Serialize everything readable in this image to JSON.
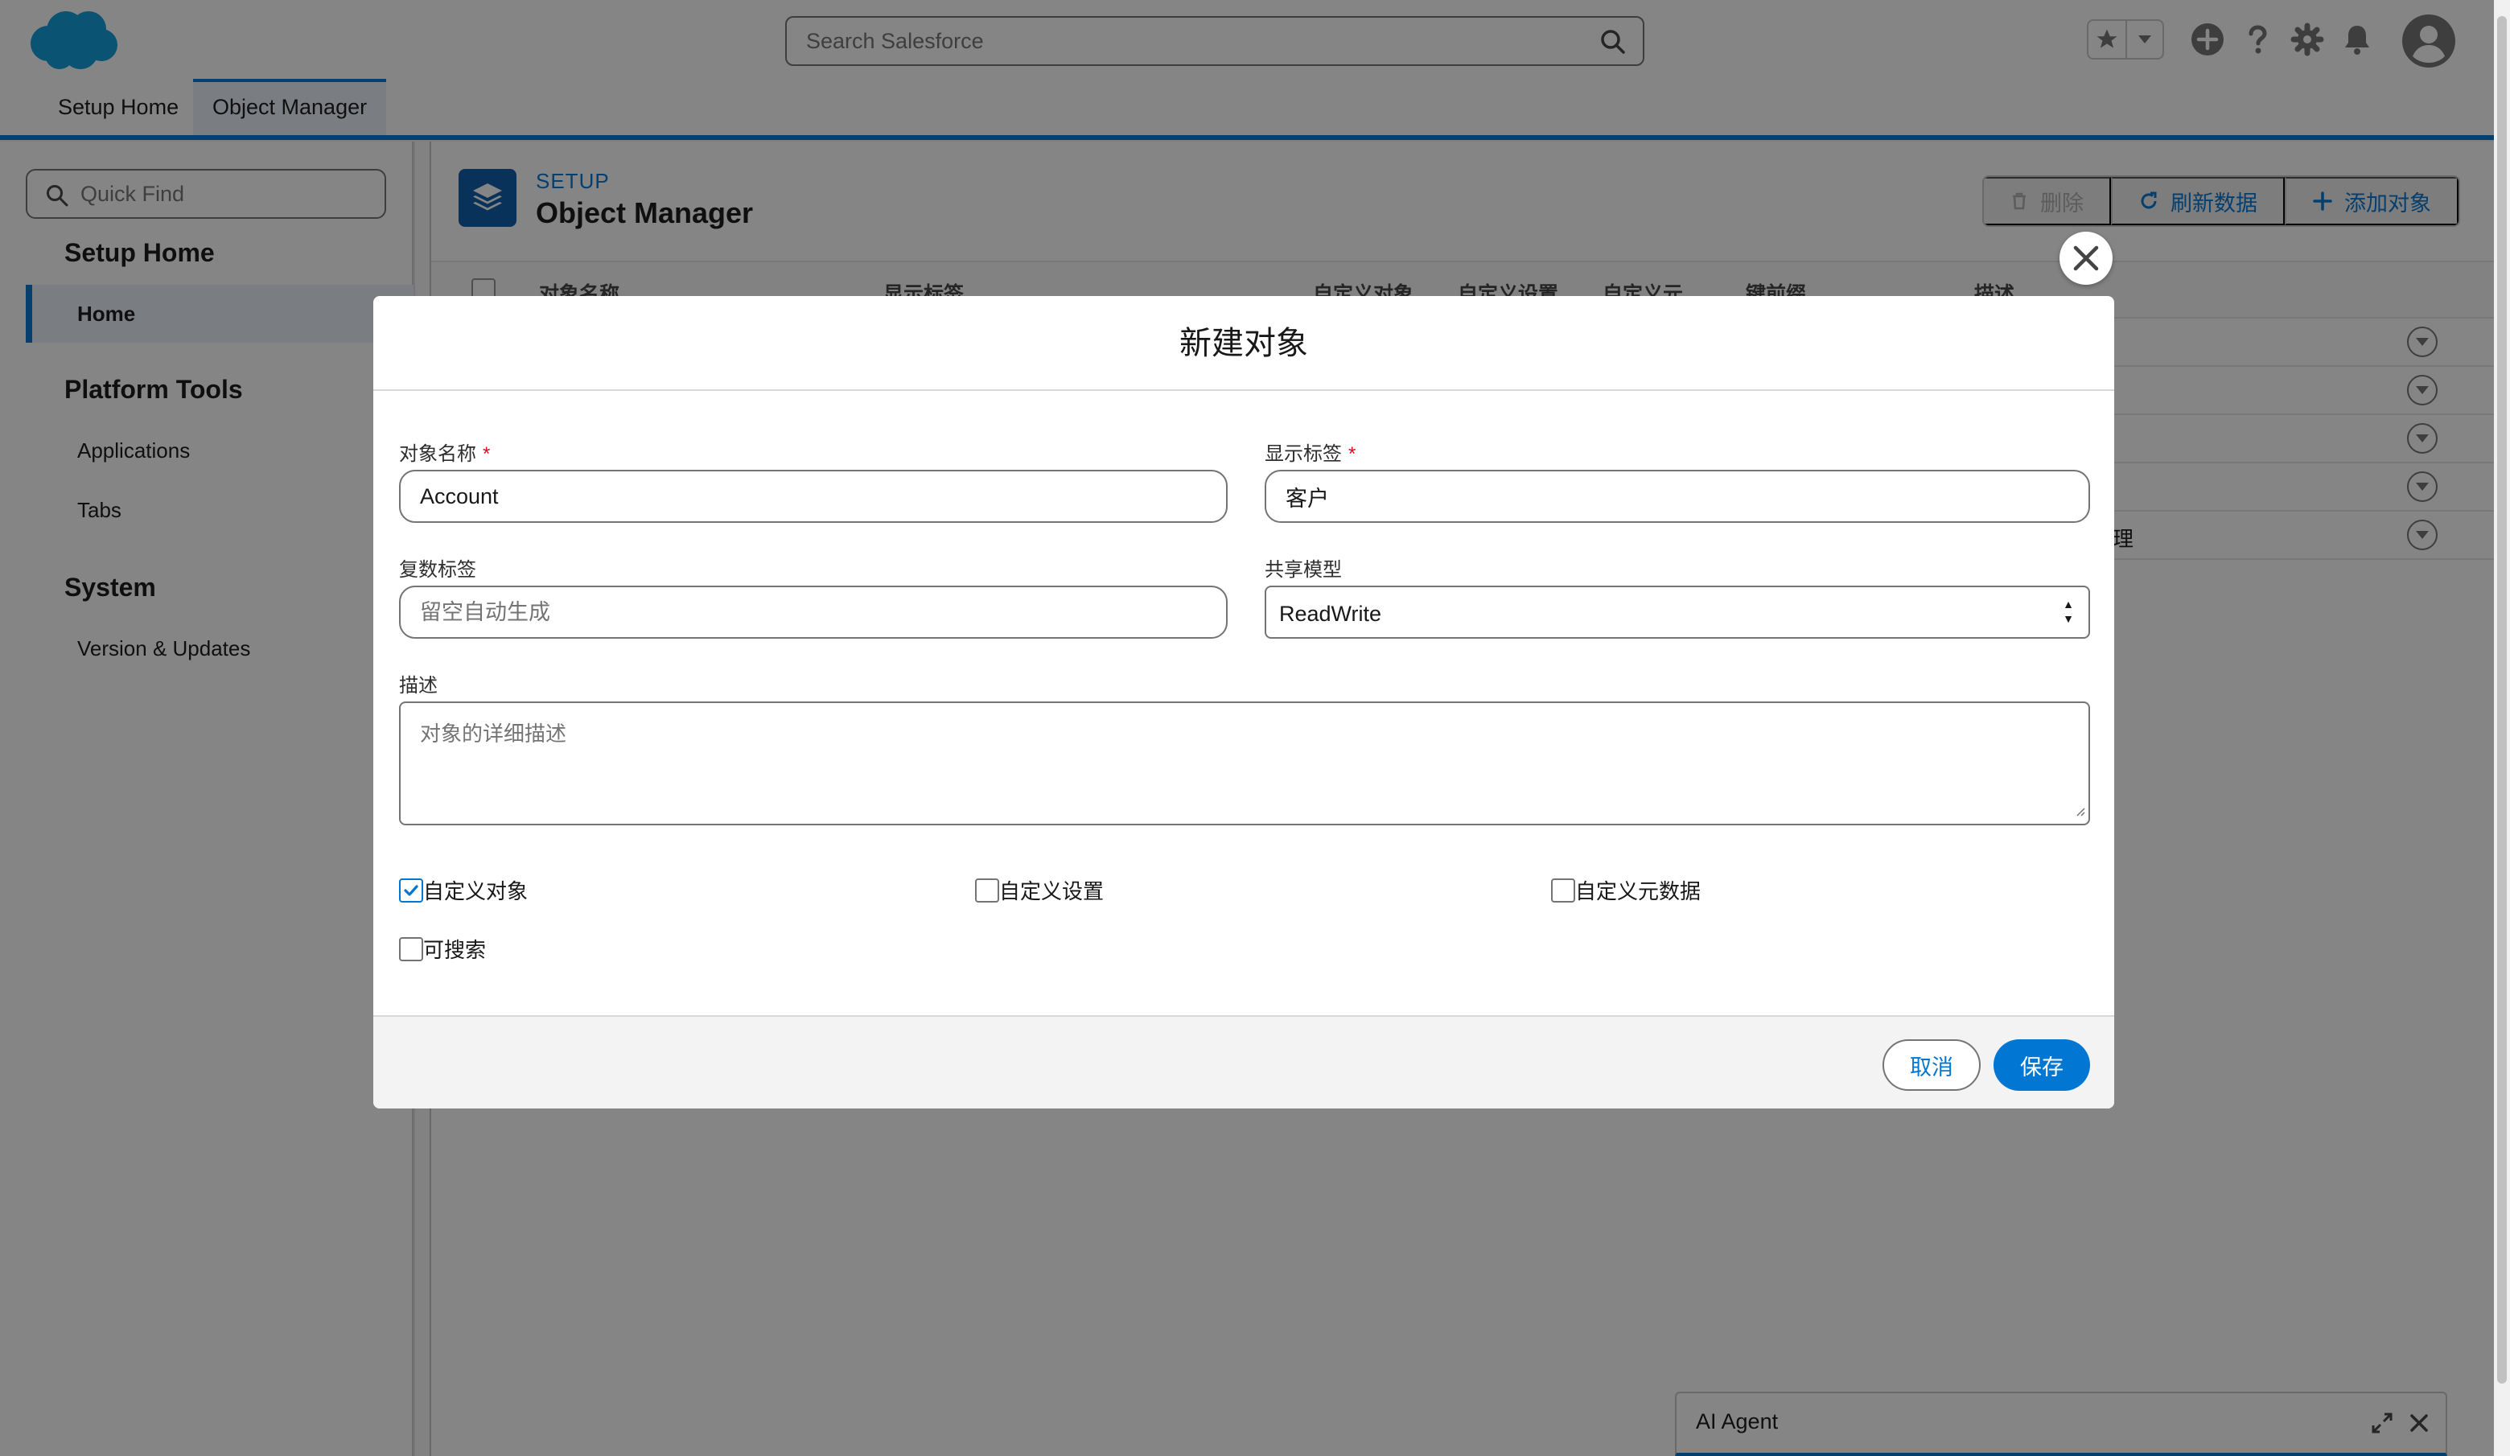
{
  "header": {
    "logo_icon": "salesforce-cloud-logo",
    "search_placeholder": "Search Salesforce",
    "icons": [
      "search-icon",
      "favorites-star-icon",
      "chevron-down-icon",
      "add-icon",
      "help-icon",
      "gear-icon",
      "bell-icon",
      "avatar-icon"
    ]
  },
  "nav": {
    "tabs": [
      {
        "label": "Setup Home"
      },
      {
        "label": "Object Manager",
        "active": true
      }
    ]
  },
  "sidebar": {
    "quick_find_placeholder": "Quick Find",
    "sections": [
      {
        "heading": "Setup Home",
        "items": [
          {
            "label": "Home",
            "active": true
          }
        ]
      },
      {
        "heading": "Platform Tools",
        "items": [
          {
            "label": "Applications"
          },
          {
            "label": "Tabs"
          }
        ]
      },
      {
        "heading": "System",
        "items": [
          {
            "label": "Version & Updates"
          }
        ]
      }
    ]
  },
  "main": {
    "setup_label": "SETUP",
    "title": "Object Manager",
    "buttons": {
      "delete": "删除",
      "refresh": "刷新数据",
      "add": "添加对象"
    },
    "table": {
      "columns": [
        "对象名称",
        "显示标签",
        "自定义对象",
        "自定义设置",
        "自定义元...",
        "键前缀",
        "描述"
      ],
      "row_count": 5,
      "visible_row_text": [
        "",
        "",
        "",
        "",
        "理"
      ]
    }
  },
  "modal": {
    "title": "新建对象",
    "fields": {
      "object_name": {
        "label": "对象名称",
        "required_mark": "*",
        "value": "Account"
      },
      "display_label": {
        "label": "显示标签",
        "required_mark": "*",
        "value": "客户"
      },
      "plural_label": {
        "label": "复数标签",
        "placeholder": "留空自动生成",
        "value": ""
      },
      "sharing_model": {
        "label": "共享模型",
        "value": "ReadWrite"
      },
      "description": {
        "label": "描述",
        "placeholder": "对象的详细描述",
        "value": ""
      }
    },
    "checkboxes": [
      {
        "label": "自定义对象",
        "checked": true
      },
      {
        "label": "自定义设置",
        "checked": false
      },
      {
        "label": "自定义元数据",
        "checked": false
      },
      {
        "label": "可搜索",
        "checked": false
      }
    ],
    "cancel_label": "取消",
    "save_label": "保存"
  },
  "agent": {
    "title": "AI Agent"
  },
  "colors": {
    "brand": "#0176d3",
    "logo": "#0d9dda",
    "required": "#ea001e",
    "overlay": "rgba(8,7,7,0.49)"
  }
}
